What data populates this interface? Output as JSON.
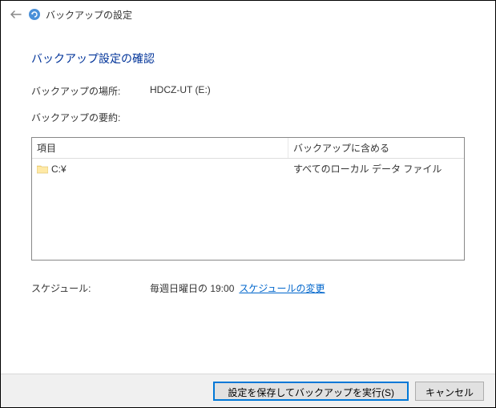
{
  "header": {
    "title": "バックアップの設定"
  },
  "page": {
    "heading": "バックアップ設定の確認"
  },
  "location": {
    "label": "バックアップの場所:",
    "value": "HDCZ-UT (E:)"
  },
  "summary": {
    "label": "バックアップの要約:",
    "columns": {
      "item": "項目",
      "include": "バックアップに含める"
    },
    "rows": [
      {
        "item": "C:¥",
        "include": "すべてのローカル データ ファイル"
      }
    ]
  },
  "schedule": {
    "label": "スケジュール:",
    "value": "毎週日曜日の 19:00",
    "change_link": "スケジュールの変更"
  },
  "footer": {
    "save_run": "設定を保存してバックアップを実行(S)",
    "cancel": "キャンセル"
  }
}
